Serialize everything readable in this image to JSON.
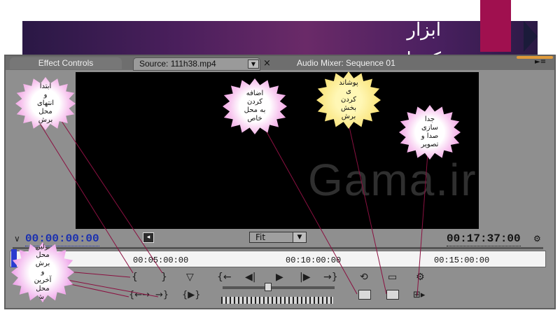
{
  "slide": {
    "title": "ابزار\nکنترل"
  },
  "panel": {
    "tabs": [
      {
        "label": "Effect Controls"
      },
      {
        "label": "Source: 111h38.mp4"
      },
      {
        "label": "Audio Mixer: Sequence 01"
      }
    ],
    "close_glyph": "×",
    "menu_glyph": "►≡",
    "dropdown_glyph": "▼"
  },
  "monitor": {
    "watermark": "Gama.ir",
    "timecode_current": "00:00:00:00",
    "timecode_duration": "00:17:37:00",
    "zoom_select": {
      "selected": "Fit"
    },
    "ruler_ticks": [
      "00:05:00:00",
      "00:10:00:00",
      "00:15:00:00"
    ]
  },
  "callouts": {
    "in_out_points": "ابتدا\nو\nانتهای\nمحل\nبرش",
    "insert": "اضافه\nکردن\nبه محل\nخاص",
    "overlay": "پوشاند\nی\nکردن\nبخش\nبرش",
    "separate_av": "جدا\nسازی\nصدا و\nتصویر",
    "goto_in_out": "اولین\nمحل\nبرش\nو\nآخرین\nمحل\nبرش"
  },
  "colors": {
    "band": "#4a1f5c",
    "accent": "#a0104f",
    "panel_bg": "#8f8f8f",
    "timecode_blue": "#1a2fb0",
    "playhead": "#2a3ccf",
    "callout_pink": "#e882d8",
    "callout_yellow": "#f4d45a",
    "pointer_line": "#8a1040"
  },
  "icons": [
    "mark-in-icon",
    "mark-out-icon",
    "unnumbered-marker-icon",
    "goto-in-icon",
    "step-back-icon",
    "play-icon",
    "step-forward-icon",
    "goto-out-icon",
    "loop-icon",
    "safe-margins-icon",
    "output-icon",
    "clear-in-out-icon",
    "play-in-to-out-icon",
    "insert-icon",
    "overlay-icon",
    "take-audio-video-icon",
    "wrench-icon"
  ]
}
